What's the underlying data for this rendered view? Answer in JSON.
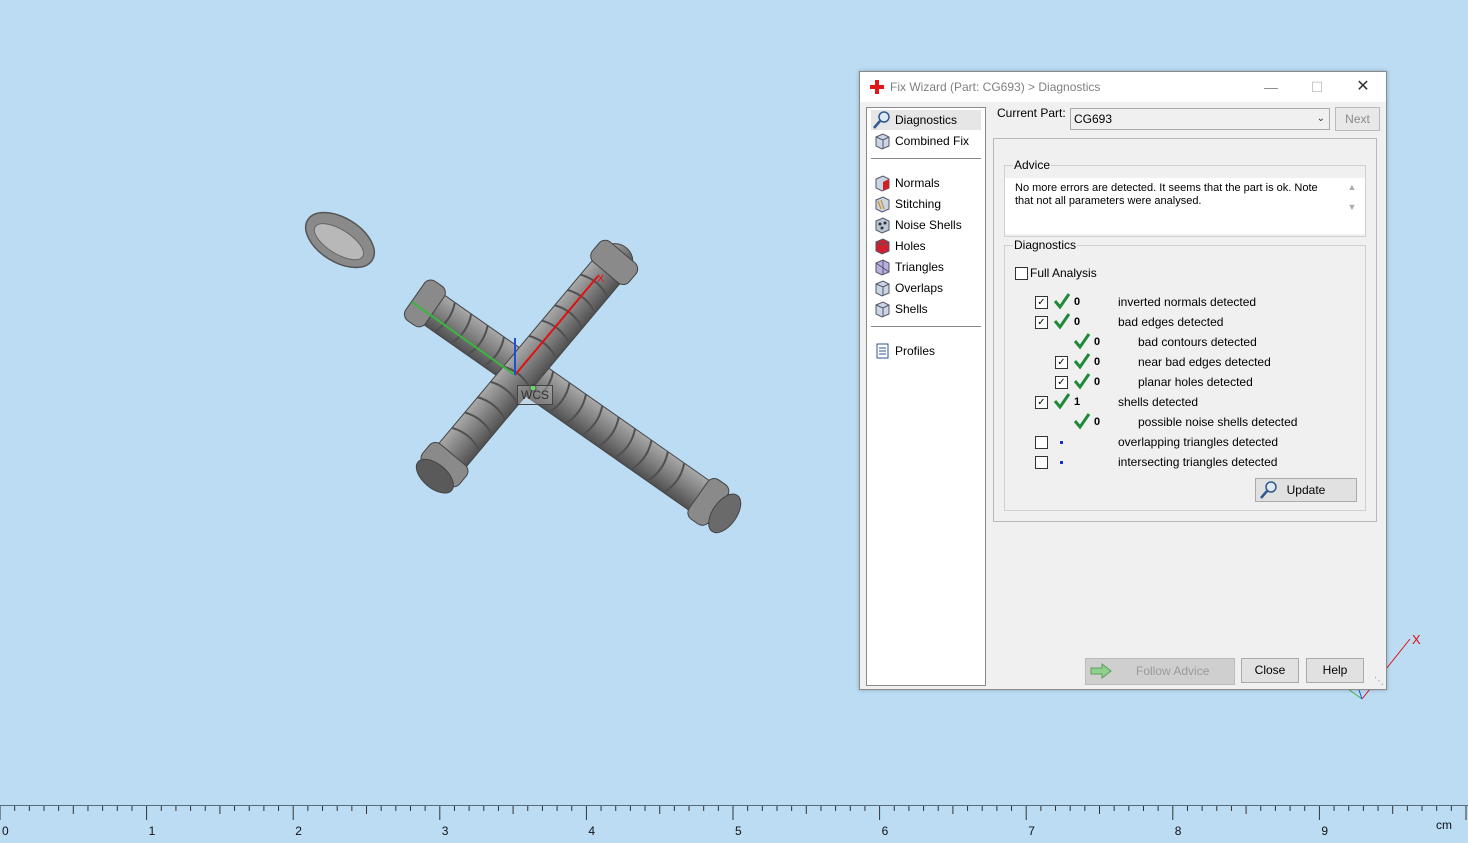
{
  "viewport": {
    "wcs_label": "WCS",
    "axis_x_label": "X"
  },
  "ruler": {
    "ticks": [
      "0",
      "1",
      "2",
      "3",
      "4",
      "5",
      "6",
      "7",
      "8",
      "9"
    ],
    "unit": "cm"
  },
  "dialog": {
    "title": "Fix Wizard (Part: CG693) > Diagnostics",
    "icon": "red-cross-icon",
    "nav": {
      "top": [
        {
          "label": "Diagnostics",
          "icon": "magnifier-icon",
          "selected": true
        },
        {
          "label": "Combined Fix",
          "icon": "cube-icon"
        }
      ],
      "fixes": [
        {
          "label": "Normals",
          "icon": "normals-cube-icon"
        },
        {
          "label": "Stitching",
          "icon": "stitching-cube-icon"
        },
        {
          "label": "Noise Shells",
          "icon": "noise-shells-icon"
        },
        {
          "label": "Holes",
          "icon": "holes-cube-icon"
        },
        {
          "label": "Triangles",
          "icon": "triangles-cube-icon"
        },
        {
          "label": "Overlaps",
          "icon": "overlaps-cube-icon"
        },
        {
          "label": "Shells",
          "icon": "shells-cube-icon"
        }
      ],
      "bottom": [
        {
          "label": "Profiles",
          "icon": "document-icon"
        }
      ]
    },
    "current_part_label": "Current Part:",
    "current_part_value": "CG693",
    "next_label": "Next",
    "advice": {
      "title": "Advice",
      "text": "No more errors are detected. It seems that the part is ok. Note that not all parameters were analysed."
    },
    "diagnostics": {
      "title": "Diagnostics",
      "full_analysis_label": "Full Analysis",
      "full_analysis_checked": false,
      "rows": [
        {
          "checkbox": true,
          "checked": true,
          "status": "ok",
          "count": "0",
          "label": "inverted normals detected",
          "indent": 0
        },
        {
          "checkbox": true,
          "checked": true,
          "status": "ok",
          "count": "0",
          "label": "bad edges detected",
          "indent": 0
        },
        {
          "checkbox": false,
          "checked": false,
          "status": "ok",
          "count": "0",
          "label": "bad contours detected",
          "indent": 1
        },
        {
          "checkbox": true,
          "checked": true,
          "status": "ok",
          "count": "0",
          "label": "near bad edges detected",
          "indent": 1
        },
        {
          "checkbox": true,
          "checked": true,
          "status": "ok",
          "count": "0",
          "label": "planar holes detected",
          "indent": 1
        },
        {
          "checkbox": true,
          "checked": true,
          "status": "ok",
          "count": "1",
          "label": "shells detected",
          "indent": 0
        },
        {
          "checkbox": false,
          "checked": false,
          "status": "ok",
          "count": "0",
          "label": "possible noise shells detected",
          "indent": 1
        },
        {
          "checkbox": true,
          "checked": false,
          "status": "none",
          "count": "",
          "label": "overlapping triangles detected",
          "indent": 0
        },
        {
          "checkbox": true,
          "checked": false,
          "status": "none",
          "count": "",
          "label": "intersecting triangles detected",
          "indent": 0
        }
      ],
      "update_label": "Update"
    },
    "follow_advice_label": "Follow Advice",
    "close_label": "Close",
    "help_label": "Help"
  },
  "colors": {
    "background": "#bcdcf4",
    "check_green": "#1f8a3a",
    "dot_blue": "#1a2ec8"
  }
}
